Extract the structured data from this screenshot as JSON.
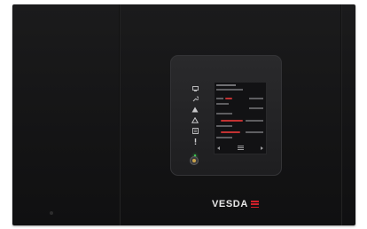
{
  "device": {
    "brand_name": "VESDA",
    "accent_color": "#d0202a",
    "led_color": "#3fcf55"
  },
  "status_icons": [
    {
      "icon": "computer-icon"
    },
    {
      "icon": "wrench-icon"
    },
    {
      "icon": "warning-filled-icon"
    },
    {
      "icon": "warning-outline-icon"
    },
    {
      "icon": "list-icon"
    },
    {
      "icon": "exclamation-icon"
    },
    {
      "icon": "power-led-icon"
    }
  ],
  "display": {
    "rows": [
      {
        "label": "",
        "value": "",
        "level": 0.22
      }
    ],
    "readings": [
      {
        "value": "",
        "level": 0.22
      },
      {
        "value": "",
        "level": 0.0
      },
      {
        "value": "",
        "level": 0.55
      },
      {
        "value": "",
        "level": 0.48
      }
    ],
    "nav": {
      "left": "previous-arrow-icon",
      "menu": "menu-icon",
      "right": "next-arrow-icon"
    }
  }
}
